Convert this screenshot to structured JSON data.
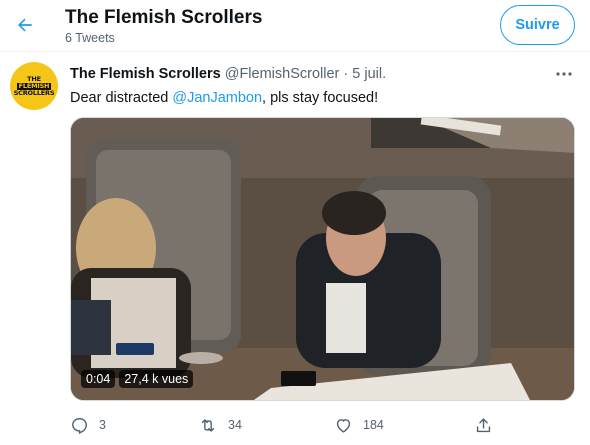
{
  "header": {
    "title": "The Flemish Scrollers",
    "subtitle": "6 Tweets",
    "follow_label": "Suivre"
  },
  "avatar": {
    "line1": "THE",
    "line2": "FLEMISH",
    "line3": "SCROLLERS"
  },
  "tweet": {
    "name": "The Flemish Scrollers",
    "handle": "@FlemishScroller",
    "separator": "·",
    "date": "5 juil.",
    "text_before": "Dear distracted ",
    "mention": "@JanJambon",
    "text_after": ", pls stay focused!"
  },
  "media": {
    "duration": "0:04",
    "views": "27,4 k vues"
  },
  "actions": {
    "replies": "3",
    "retweets": "34",
    "likes": "184"
  },
  "colors": {
    "accent": "#1d9bf0",
    "secondary_text": "#536471",
    "avatar_bg": "#f5c518"
  }
}
